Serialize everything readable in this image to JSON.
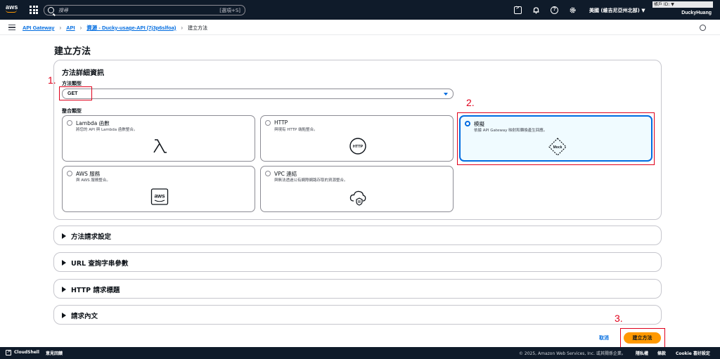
{
  "topnav": {
    "logo_text": "aws",
    "search_placeholder": "搜尋",
    "search_shortcut": "[選項+S]",
    "region": "美國 (維吉尼亞州北部) ▼",
    "account_label": "帳戶 ID: ▼",
    "username": "DuckyHuang"
  },
  "breadcrumb": {
    "items": [
      "API Gateway",
      "API",
      "資源 - Ducky-usage-API (7j3p6slfoa)"
    ],
    "current": "建立方法"
  },
  "page": {
    "title": "建立方法"
  },
  "method_details": {
    "title": "方法詳細資訊",
    "method_type_label": "方法類型",
    "method_type_value": "GET",
    "integration_type_label": "整合類型",
    "options": [
      {
        "title": "Lambda 函數",
        "desc": "將您的 API 與 Lambda 函數整合。",
        "selected": false,
        "icon": "lambda-icon"
      },
      {
        "title": "HTTP",
        "desc": "與現有 HTTP 端點整合。",
        "selected": false,
        "icon": "http-icon"
      },
      {
        "title": "模擬",
        "desc": "依據 API Gateway 映射和轉換產生回應。",
        "selected": true,
        "icon": "mock-icon"
      },
      {
        "title": "AWS 服務",
        "desc": "與 AWS 服務整合。",
        "selected": false,
        "icon": "aws-service-icon"
      },
      {
        "title": "VPC 連結",
        "desc": "與無法透過公有網際網路存取的資源整合。",
        "selected": false,
        "icon": "vpc-link-icon"
      }
    ],
    "http_icon_text": "HTTP",
    "mock_icon_text": "Mock",
    "aws_icon_text": "aws"
  },
  "accordions": [
    {
      "label": "方法請求設定"
    },
    {
      "label": "URL 查詢字串參數"
    },
    {
      "label": "HTTP 請求標題"
    },
    {
      "label": "請求內文"
    }
  ],
  "actions": {
    "cancel": "取消",
    "create": "建立方法"
  },
  "annotations": [
    "1.",
    "2.",
    "3."
  ],
  "footer": {
    "cloudshell": "CloudShell",
    "feedback": "意見回饋",
    "copyright": "© 2025, Amazon Web Services, Inc. 或其關係企業。",
    "privacy": "隱私權",
    "terms": "條款",
    "cookie": "Cookie 喜好設定"
  },
  "colors": {
    "nav_bg": "#0f1b2a",
    "accent_blue": "#006ce0",
    "primary_button": "#ff9900",
    "annotation_red": "#e0001b"
  }
}
